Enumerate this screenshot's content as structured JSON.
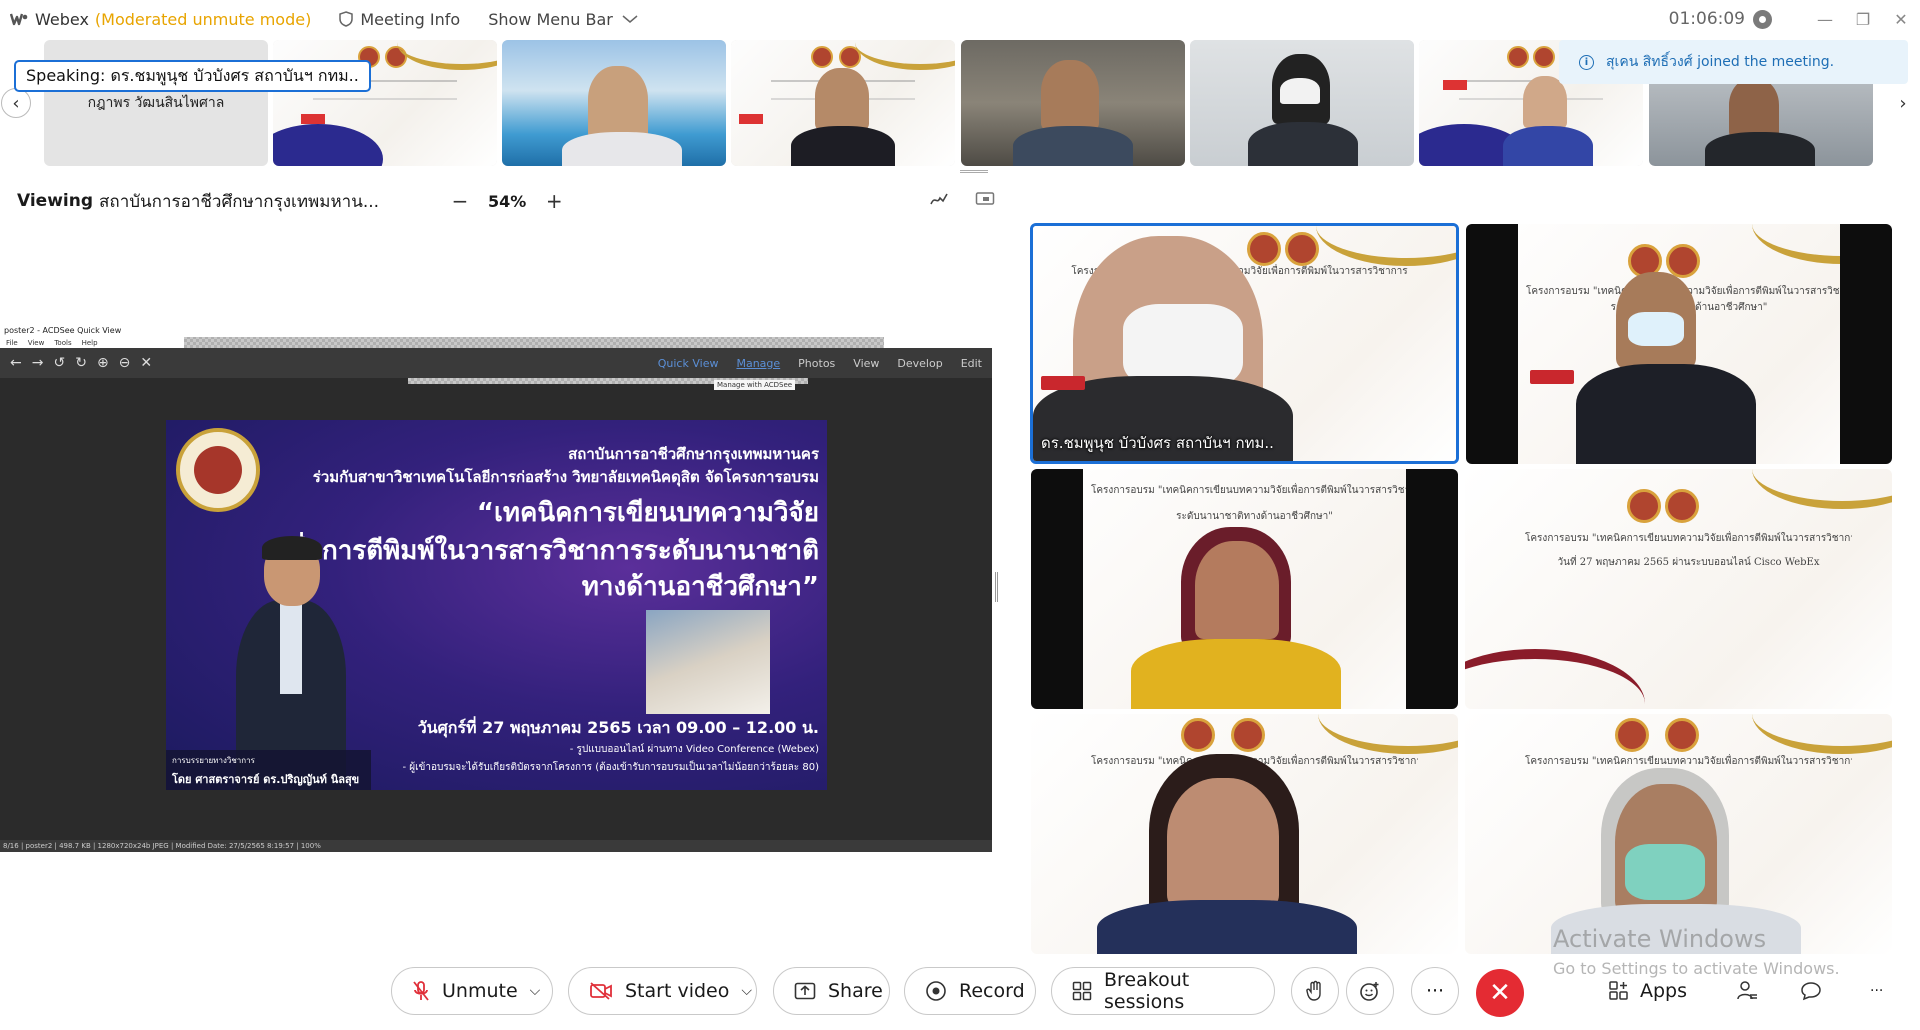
{
  "app": {
    "name": "Webex",
    "mode": "(Moderated unmute mode)",
    "meeting_info": "Meeting Info",
    "show_menu_bar": "Show Menu Bar",
    "timer": "01:06:09"
  },
  "toast": {
    "message": "สุเคน สิทธิ์วงศ์ joined the meeting."
  },
  "filmstrip": {
    "speaking": "Speaking: ดร.ชมพูนุช บัวบังศร สถาบันฯ กทม..",
    "name_tile": "กฎาพร วัฒนสินไพศาล"
  },
  "viewing": {
    "label": "Viewing",
    "title": "สถาบันการอาชีวศึกษากรุงเทพมหาน...",
    "zoom": "54%"
  },
  "acdsee": {
    "window_title": "poster2 - ACDSee Quick View",
    "menu": [
      "File",
      "View",
      "Tools",
      "Help"
    ],
    "tabs": {
      "quick_view": "Quick View",
      "manage": "Manage",
      "photos": "Photos",
      "view": "View",
      "develop": "Develop",
      "edit": "Edit"
    },
    "tooltip": "Manage with ACDSee",
    "status": "8/16 | poster2 | 498.7 KB | 1280x720x24b JPEG | Modified Date: 27/5/2565 8:19:57 | 100%"
  },
  "poster": {
    "line1": "สถาบันการอาชีวศึกษากรุงเทพมหานคร",
    "line2": "ร่วมกับสาขาวิชาเทคโนโลยีการก่อสร้าง วิทยาลัยเทคนิคดุสิต จัดโครงการอบรม",
    "headline1": "“เทคนิคการเขียนบทความวิจัย",
    "headline2": "เพื่อการตีพิมพ์ในวารสารวิชาการระดับนานาชาติ",
    "headline3": "ทางด้านอาชีวศึกษา”",
    "date": "วันศุกร์ที่ 27 พฤษภาคม 2565 เวลา 09.00 – 12.00 น.",
    "bullet1": "- รูปแบบออนไลน์ ผ่านทาง Video Conference (Webex)",
    "bullet2": "- ผู้เข้าอบรมจะได้รับเกียรติบัตรจากโครงการ (ต้องเข้ารับการอบรมเป็นเวลาไม่น้อยกว่าร้อยละ 80)",
    "caption1": "การบรรยายทางวิชาการ",
    "caption2": "โดย ศาสตราจารย์ ดร.ปริญญันท์ นิลสุข"
  },
  "grid": {
    "active_name": "ดร.ชมพูนุช บัวบังศร สถาบันฯ กทม..",
    "slide_title": "โครงการอบรม \"เทคนิคการเขียนบทความวิจัยเพื่อการตีพิมพ์ในวารสารวิชาการ",
    "slide_sub": "ระดับนานาชาติทางด้านอาชีวศึกษา\"",
    "slide_date": "วันที่ 27 พฤษภาคม 2565 ผ่านระบบออนไลน์ Cisco WebEx"
  },
  "watermark": {
    "line1": "Activate Windows",
    "line2": "Go to Settings to activate Windows."
  },
  "controls": {
    "unmute": "Unmute",
    "start_video": "Start video",
    "share": "Share",
    "record": "Record",
    "breakout": "Breakout sessions",
    "apps": "Apps",
    "more": "···"
  }
}
